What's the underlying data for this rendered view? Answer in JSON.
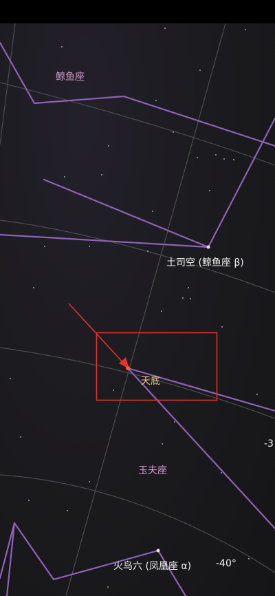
{
  "constellations": {
    "cetus": "鲸鱼座",
    "sculptor": "玉夫座"
  },
  "stars": {
    "diphda": "土司空 (鲸鱼座 β)",
    "ankaa": "火鸟六 (凤凰座 α)"
  },
  "target": {
    "label": "天底"
  },
  "declination": {
    "minus_30": "-3",
    "minus_40": "-40°"
  },
  "colors": {
    "background": "#1c1b1f",
    "constellation_line": "#8e62b8",
    "grid_line": "#4a4d4e",
    "highlight": "#e0332b",
    "target_label": "#f2c98a",
    "constellation_label": "#d79bd0"
  }
}
